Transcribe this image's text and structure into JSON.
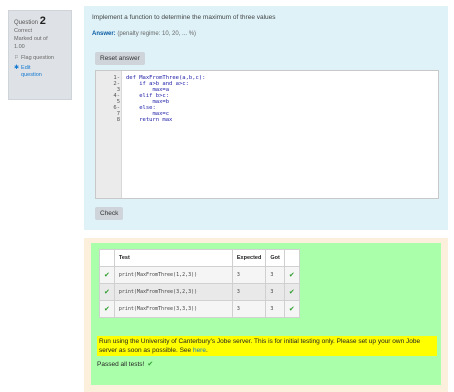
{
  "question_info": {
    "label": "Question",
    "number": "2",
    "status": "Correct",
    "marked": "Marked out of",
    "mark_value": "1.00",
    "flag_label": "Flag question",
    "edit_label_1": "Edit",
    "edit_label_2": "question"
  },
  "question": {
    "prompt": "Implement a function to determine the maximum of three values",
    "answer_label": "Answer:",
    "penalty": "(penalty regime: 10, 20, ... %)",
    "reset_label": "Reset answer",
    "check_label": "Check"
  },
  "editor": {
    "lines": [
      {
        "num": "1",
        "fold": "-",
        "code": "def MaxFromThree(a,b,c):"
      },
      {
        "num": "2",
        "fold": "-",
        "code": "    if a>b and a>c:"
      },
      {
        "num": "3",
        "fold": "",
        "code": "        max=a"
      },
      {
        "num": "4",
        "fold": "-",
        "code": "    elif b>c:"
      },
      {
        "num": "5",
        "fold": "",
        "code": "        max=b"
      },
      {
        "num": "6",
        "fold": "-",
        "code": "    else:"
      },
      {
        "num": "7",
        "fold": "",
        "code": "        max=c"
      },
      {
        "num": "8",
        "fold": "",
        "code": "    return max"
      }
    ]
  },
  "results": {
    "headers": [
      "Test",
      "Expected",
      "Got"
    ],
    "rows": [
      {
        "test": "print(MaxFromThree(1,2,3))",
        "expected": "3",
        "got": "3"
      },
      {
        "test": "print(MaxFromThree(3,2,3))",
        "expected": "3",
        "got": "3"
      },
      {
        "test": "print(MaxFromThree(3,3,3))",
        "expected": "3",
        "got": "3"
      }
    ],
    "notice_text": "Run using the University of Canterbury's Jobe server. This is for initial testing only. Please set up your own Jobe server as soon as possible. See ",
    "notice_link": "here",
    "notice_end": ".",
    "passed_text": "Passed all tests!"
  },
  "colors": {
    "info_bg": "#dee2e6",
    "question_bg": "#def2f8",
    "feedback_bg": "#fcefdc",
    "results_bg": "#aaffaa",
    "notice_bg": "#ffff00",
    "tick": "#2e9e2e"
  }
}
